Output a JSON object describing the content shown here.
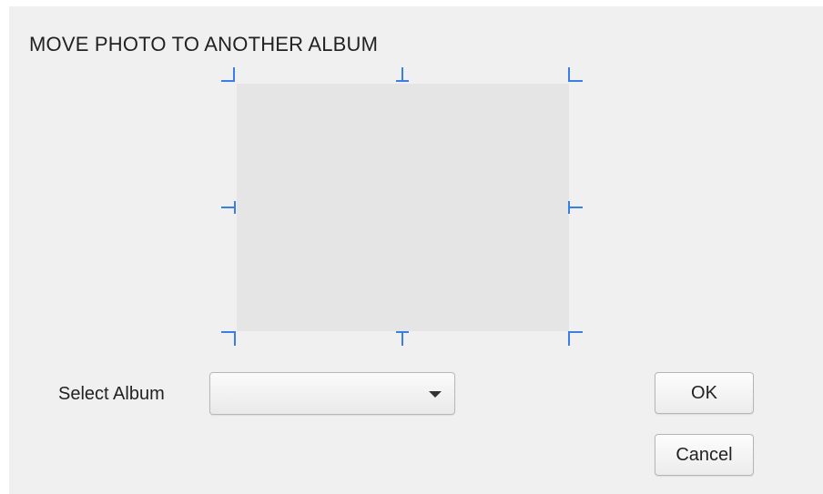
{
  "dialog": {
    "title": "MOVE PHOTO TO ANOTHER ALBUM",
    "crop_handle_color": "#3a7ee8",
    "preview_background": "#e5e5e5"
  },
  "album_select": {
    "label": "Select Album",
    "selected_value": ""
  },
  "buttons": {
    "ok_label": "OK",
    "cancel_label": "Cancel"
  }
}
